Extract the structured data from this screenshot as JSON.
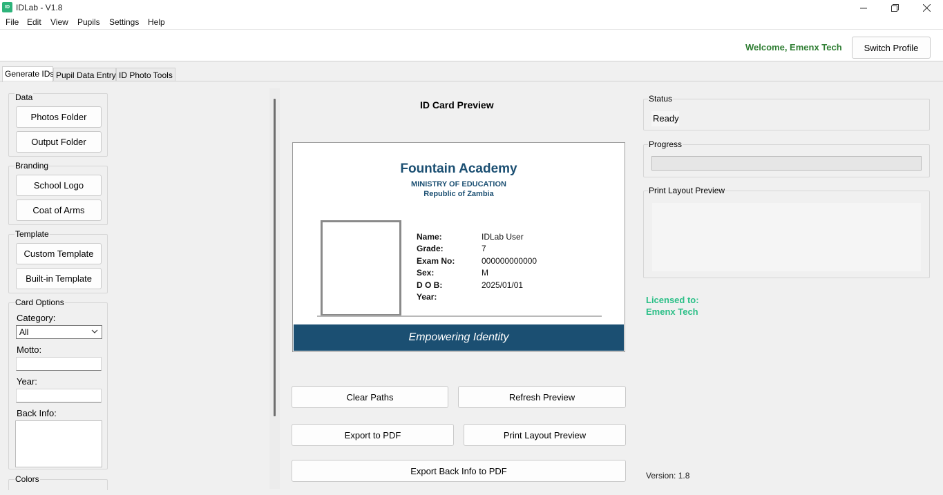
{
  "app": {
    "title": "IDLab - V1.8",
    "icon_name": "idlab-app-icon",
    "icon_text": "ID"
  },
  "menu": [
    "File",
    "Edit",
    "View",
    "Pupils",
    "Settings",
    "Help"
  ],
  "header": {
    "welcome": "Welcome, Emenx Tech",
    "switch_profile": "Switch Profile"
  },
  "tabs": [
    "Generate IDs",
    "Pupil Data Entry",
    "ID Photo Tools"
  ],
  "left": {
    "data_group": "Data",
    "photos_folder": "Photos Folder",
    "output_folder": "Output Folder",
    "branding_group": "Branding",
    "school_logo": "School Logo",
    "coat_of_arms": "Coat of Arms",
    "template_group": "Template",
    "custom_template": "Custom Template",
    "builtin_template": "Built-in Template",
    "card_options_group": "Card Options",
    "category_label": "Category:",
    "category_value": "All",
    "motto_label": "Motto:",
    "motto_value": "",
    "year_label": "Year:",
    "year_value": "",
    "back_info_label": "Back Info:",
    "back_info_value": "",
    "colors_group": "Colors"
  },
  "preview": {
    "title": "ID Card Preview",
    "card": {
      "school": "Fountain Academy",
      "ministry": "MINISTRY OF EDUCATION",
      "republic": "Republic of Zambia",
      "fields": [
        {
          "label": "Name:",
          "value": "IDLab User"
        },
        {
          "label": "Grade:",
          "value": "7"
        },
        {
          "label": "Exam No:",
          "value": "000000000000"
        },
        {
          "label": "Sex:",
          "value": "M"
        },
        {
          "label": "D O B:",
          "value": "2025/01/01"
        },
        {
          "label": "Year:",
          "value": ""
        }
      ],
      "motto": "Empowering Identity",
      "band_color": "#1b4f72"
    },
    "buttons": {
      "clear_paths": "Clear Paths",
      "refresh_preview": "Refresh Preview",
      "export_pdf": "Export to PDF",
      "print_layout_preview": "Print Layout Preview",
      "export_back_info": "Export Back Info to PDF"
    }
  },
  "right": {
    "status_group": "Status",
    "status_value": "Ready",
    "progress_group": "Progress",
    "progress_value": 0,
    "print_layout_group": "Print Layout Preview",
    "licensed_to_label": "Licensed to:",
    "licensed_to_name": "Emenx Tech",
    "version": "Version: 1.8",
    "license_color": "#2bbf87"
  },
  "colors": {
    "welcome": "#2e7d32",
    "brand": "#1b4f72"
  }
}
